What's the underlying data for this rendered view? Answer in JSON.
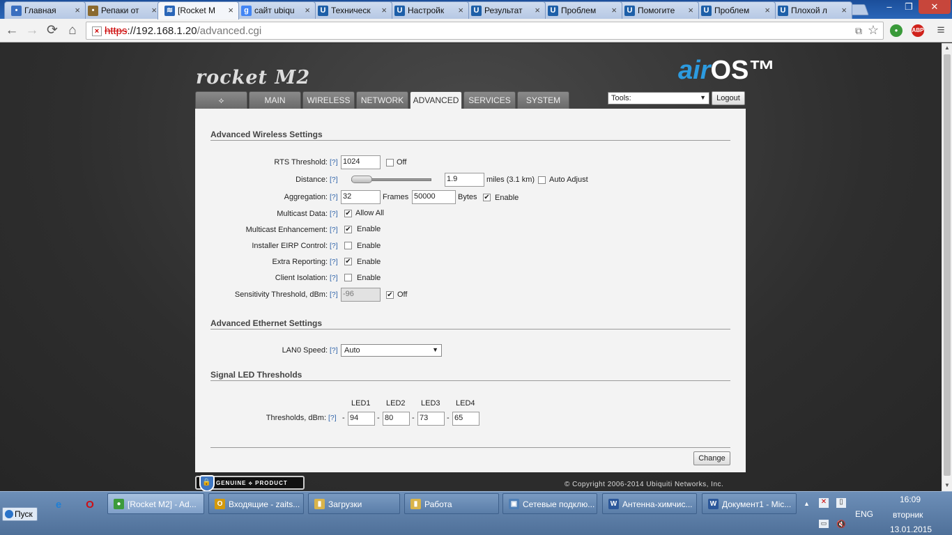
{
  "browser": {
    "tabs": [
      {
        "label": "Главная",
        "icon": "people-icon",
        "color": "#3a6fc0"
      },
      {
        "label": "Репаки от",
        "icon": "tools-icon",
        "color": "#8a6a30"
      },
      {
        "label": "[Rocket M",
        "icon": "wifi-icon",
        "color": "#2a66b8",
        "active": true
      },
      {
        "label": "сайт ubiqu",
        "icon": "google-icon",
        "color": "#4285f4"
      },
      {
        "label": "Техническ",
        "icon": "ubnt-icon",
        "color": "#1d5fa8"
      },
      {
        "label": "Настройк",
        "icon": "ubnt-icon",
        "color": "#1d5fa8"
      },
      {
        "label": "Результат",
        "icon": "ubnt-icon",
        "color": "#1d5fa8"
      },
      {
        "label": "Проблем",
        "icon": "ubnt-icon",
        "color": "#1d5fa8"
      },
      {
        "label": "Помогите",
        "icon": "ubnt-icon",
        "color": "#1d5fa8"
      },
      {
        "label": "Проблем",
        "icon": "ubnt-icon",
        "color": "#1d5fa8"
      },
      {
        "label": "Плохой л",
        "icon": "ubnt-icon",
        "color": "#1d5fa8"
      }
    ],
    "close_glyph": "×",
    "window": {
      "min": "–",
      "max": "❐",
      "close": "✕"
    },
    "nav": {
      "back": "←",
      "forward": "→",
      "reload": "⟳",
      "home": "⌂",
      "menu": "≡"
    },
    "url": {
      "scheme": "https",
      "host": "://192.168.1.20",
      "path": "/advanced.cgi"
    },
    "ext_labels": {
      "translate": "⧉",
      "star": "☆",
      "ext1": "●",
      "abp": "ABP"
    }
  },
  "header": {
    "product_logo": "rocket M2",
    "airos_air": "air",
    "airos_os": "OS™"
  },
  "nav_tabs": [
    {
      "label": "⟡",
      "icon": "ubiquiti-logo-icon"
    },
    {
      "label": "MAIN"
    },
    {
      "label": "WIRELESS"
    },
    {
      "label": "NETWORK"
    },
    {
      "label": "ADVANCED",
      "active": true
    },
    {
      "label": "SERVICES"
    },
    {
      "label": "SYSTEM"
    }
  ],
  "tools": {
    "value": "Tools:",
    "arrow": "▼"
  },
  "logout_label": "Logout",
  "help_text": "[?]",
  "wireless": {
    "title": "Advanced Wireless Settings",
    "rts": {
      "label": "RTS Threshold:",
      "value": "1024",
      "off_label": "Off",
      "off_checked": false
    },
    "distance": {
      "label": "Distance:",
      "value": "1.9",
      "unit": "miles (3.1 km)",
      "auto_label": "Auto Adjust",
      "auto_checked": false
    },
    "aggregation": {
      "label": "Aggregation:",
      "frames": "32",
      "frames_label": "Frames",
      "bytes": "50000",
      "bytes_label": "Bytes",
      "enable_label": "Enable",
      "enable_checked": true
    },
    "multicast": {
      "label": "Multicast Data:",
      "opt_label": "Allow All",
      "checked": true
    },
    "multicast_enh": {
      "label": "Multicast Enhancement:",
      "opt_label": "Enable",
      "checked": true
    },
    "eirp": {
      "label": "Installer EIRP Control:",
      "opt_label": "Enable",
      "checked": false
    },
    "extra_reporting": {
      "label": "Extra Reporting:",
      "opt_label": "Enable",
      "checked": true
    },
    "client_isolation": {
      "label": "Client Isolation:",
      "opt_label": "Enable",
      "checked": false
    },
    "sensitivity": {
      "label": "Sensitivity Threshold, dBm:",
      "value": "-96",
      "off_label": "Off",
      "off_checked": true
    }
  },
  "ethernet": {
    "title": "Advanced Ethernet Settings",
    "lan0": {
      "label": "LAN0 Speed:",
      "value": "Auto",
      "arrow": "▼"
    }
  },
  "led": {
    "title": "Signal LED Thresholds",
    "headers": [
      "LED1",
      "LED2",
      "LED3",
      "LED4"
    ],
    "label": "Thresholds, dBm:",
    "dash": "-",
    "values": [
      "94",
      "80",
      "73",
      "65"
    ]
  },
  "change_label": "Change",
  "genuine_label": "GENUINE ⟡ PRODUCT",
  "genuine_icon": "🔒",
  "copyright": "© Copyright 2006-2014 Ubiquiti Networks, Inc.",
  "taskbar": {
    "start": "Пуск",
    "quick": [
      {
        "icon": "ie-icon",
        "glyph": "e",
        "color": "#1e7fd6"
      },
      {
        "icon": "opera-icon",
        "glyph": "O",
        "color": "#cc0f16"
      }
    ],
    "items": [
      {
        "label": "[Rocket M2] - Ad...",
        "icon": "chrome-icon",
        "color": "#3c9b3c",
        "glyph": "●",
        "active": true
      },
      {
        "label": "Входящие - zaits...",
        "icon": "outlook-icon",
        "color": "#d49a0c",
        "glyph": "О"
      },
      {
        "label": "Загрузки",
        "icon": "folder-icon",
        "color": "#d9b44a",
        "glyph": "▮"
      },
      {
        "label": "Работа",
        "icon": "folder-icon",
        "color": "#d9b44a",
        "glyph": "▮"
      },
      {
        "label": "Сетевые подклю...",
        "icon": "network-icon",
        "color": "#4f7fb6",
        "glyph": "▣"
      },
      {
        "label": "Антенна-химчис...",
        "icon": "word-icon",
        "color": "#2b579a",
        "glyph": "W"
      },
      {
        "label": "Документ1 - Mic...",
        "icon": "word-icon",
        "color": "#2b579a",
        "glyph": "W"
      }
    ],
    "tray": {
      "up": "▲",
      "lang": "ENG",
      "time": "16:09",
      "day": "вторник",
      "date": "13.01.2015"
    }
  }
}
